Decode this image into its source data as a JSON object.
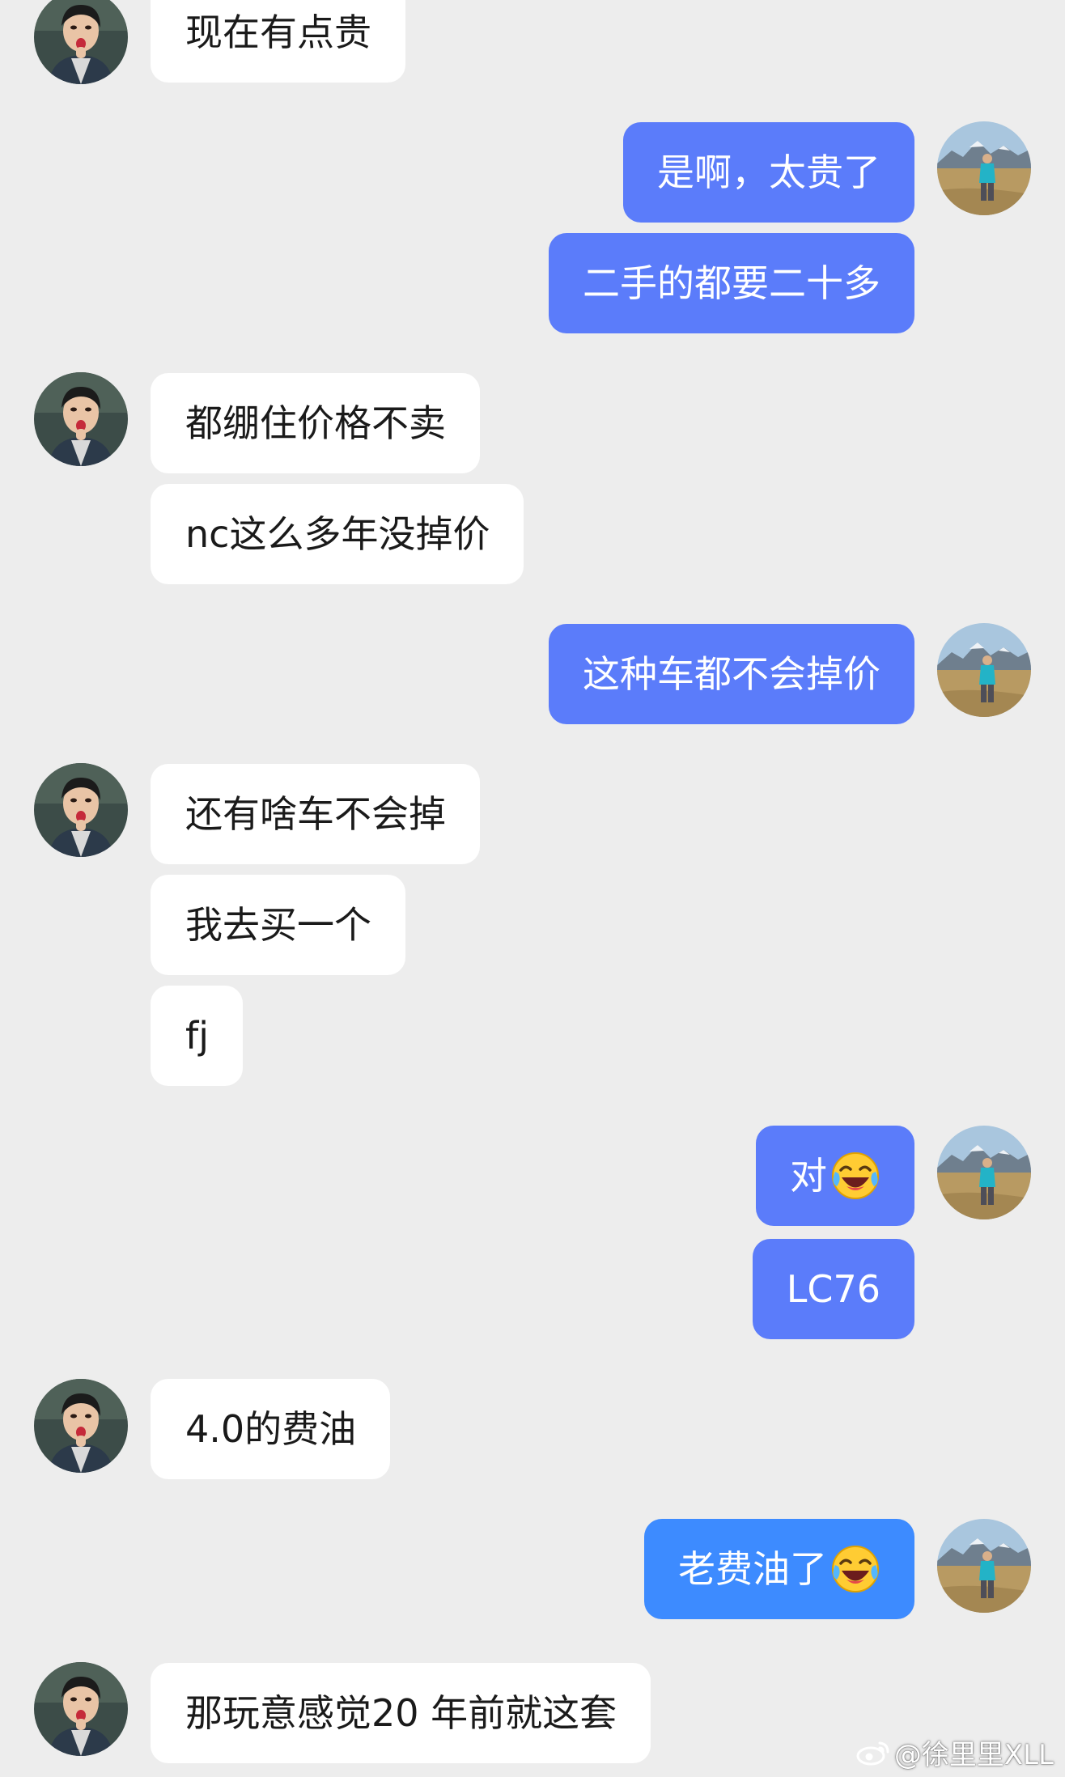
{
  "messages": [
    {
      "side": "in",
      "text": "现在有点贵"
    },
    {
      "side": "out",
      "text": "是啊，太贵了"
    },
    {
      "side": "out",
      "text": "二手的都要二十多"
    },
    {
      "side": "in",
      "text": "都绷住价格不卖"
    },
    {
      "side": "in",
      "text": "nc这么多年没掉价"
    },
    {
      "side": "out",
      "text": "这种车都不会掉价"
    },
    {
      "side": "in",
      "text": "还有啥车不会掉"
    },
    {
      "side": "in",
      "text": "我去买一个"
    },
    {
      "side": "in",
      "text": "fj"
    },
    {
      "side": "out",
      "text": "对",
      "emoji": "laughing-crying-emoji"
    },
    {
      "side": "out",
      "text": "LC76"
    },
    {
      "side": "in",
      "text": "4.0的费油"
    },
    {
      "side": "out",
      "text": "老费油了",
      "emoji": "laughing-crying-emoji"
    },
    {
      "side": "in",
      "text": "那玩意感觉20 年前就这套"
    }
  ],
  "watermark": {
    "text": "@徐里里XLL",
    "icon": "weibo-icon"
  },
  "colors": {
    "background": "#ededed",
    "incoming_bubble": "#ffffff",
    "outgoing_bubble": "#5b7cfa",
    "outgoing_bubble_alt": "#3d8bff"
  }
}
